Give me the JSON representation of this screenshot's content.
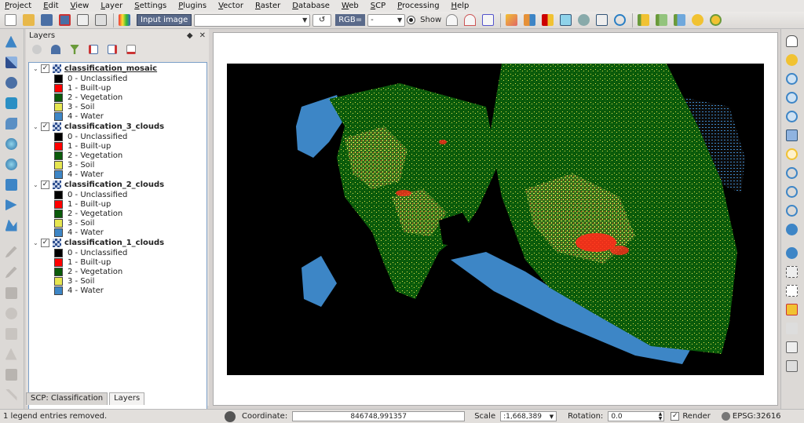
{
  "menu": [
    "Project",
    "Edit",
    "View",
    "Layer",
    "Settings",
    "Plugins",
    "Vector",
    "Raster",
    "Database",
    "Web",
    "SCP",
    "Processing",
    "Help"
  ],
  "toolbar": {
    "input_image_label": "Input image",
    "input_image_value": "",
    "rgb_label": "RGB=",
    "rgb_value": "-",
    "show_label": "Show"
  },
  "layers_panel": {
    "title": "Layers",
    "header_buttons": [
      "◆",
      "✕"
    ],
    "groups": [
      {
        "name": "classification_mosaic",
        "checked": true,
        "selected": true,
        "classes": [
          {
            "label": "0 - Unclassified",
            "color": "#000000"
          },
          {
            "label": "1 - Built-up",
            "color": "#ff0000"
          },
          {
            "label": "2 - Vegetation",
            "color": "#0a5a0a"
          },
          {
            "label": "3 - Soil",
            "color": "#e6e650"
          },
          {
            "label": "4 - Water",
            "color": "#3d86c6"
          }
        ]
      },
      {
        "name": "classification_3_clouds",
        "checked": true,
        "selected": false,
        "classes": [
          {
            "label": "0 - Unclassified",
            "color": "#000000"
          },
          {
            "label": "1 - Built-up",
            "color": "#ff0000"
          },
          {
            "label": "2 - Vegetation",
            "color": "#0a5a0a"
          },
          {
            "label": "3 - Soil",
            "color": "#e6e650"
          },
          {
            "label": "4 - Water",
            "color": "#3d86c6"
          }
        ]
      },
      {
        "name": "classification_2_clouds",
        "checked": true,
        "selected": false,
        "classes": [
          {
            "label": "0 - Unclassified",
            "color": "#000000"
          },
          {
            "label": "1 - Built-up",
            "color": "#ff0000"
          },
          {
            "label": "2 - Vegetation",
            "color": "#0a5a0a"
          },
          {
            "label": "3 - Soil",
            "color": "#e6e650"
          },
          {
            "label": "4 - Water",
            "color": "#3d86c6"
          }
        ]
      },
      {
        "name": "classification_1_clouds",
        "checked": true,
        "selected": false,
        "classes": [
          {
            "label": "0 - Unclassified",
            "color": "#000000"
          },
          {
            "label": "1 - Built-up",
            "color": "#ff0000"
          },
          {
            "label": "2 - Vegetation",
            "color": "#0a5a0a"
          },
          {
            "label": "3 - Soil",
            "color": "#e6e650"
          },
          {
            "label": "4 - Water",
            "color": "#3d86c6"
          }
        ]
      }
    ]
  },
  "tabs": [
    {
      "label": "SCP: Classification",
      "active": false
    },
    {
      "label": "Layers",
      "active": true
    }
  ],
  "statusbar": {
    "message": "1 legend entries removed.",
    "coordinate_label": "Coordinate:",
    "coordinate_value": "846748,991357",
    "scale_label": "Scale",
    "scale_value": ":1,668,389",
    "rotation_label": "Rotation:",
    "rotation_value": "0.0",
    "render_label": "Render",
    "render_checked": true,
    "crs_label": "EPSG:32616"
  },
  "colors": {
    "unclassified": "#000000",
    "builtup": "#ff0000",
    "vegetation": "#0a5a0a",
    "soil": "#e6e650",
    "water": "#3d86c6"
  }
}
